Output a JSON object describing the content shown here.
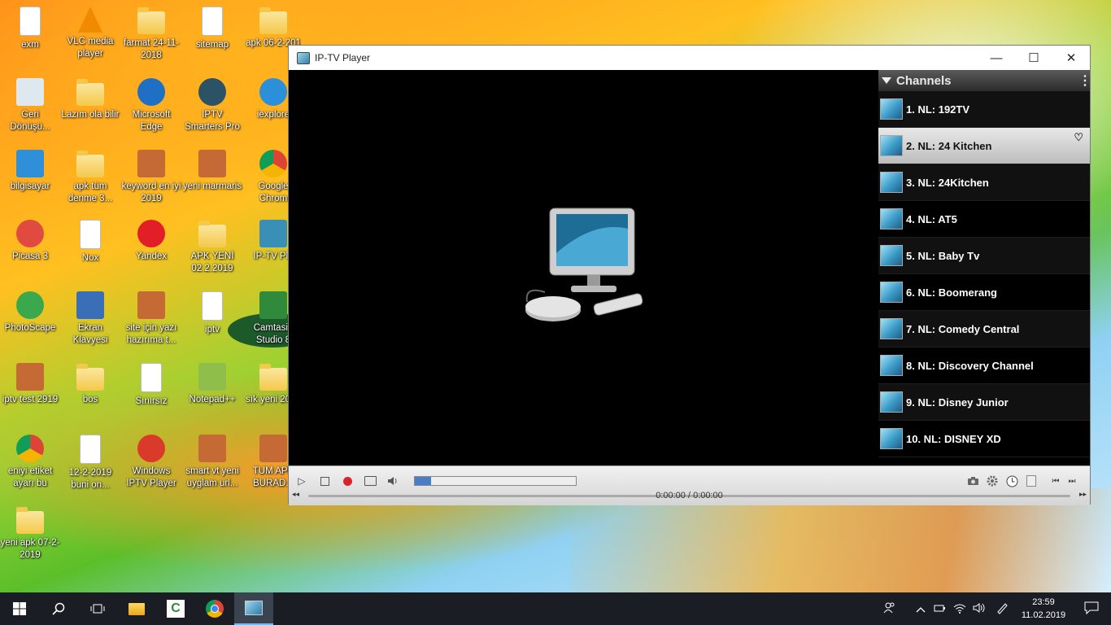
{
  "desktop": {
    "icons": [
      {
        "label": "exm",
        "type": "doc",
        "color": "#ffffff"
      },
      {
        "label": "VLC media player",
        "type": "vlc",
        "color": "#f08a00"
      },
      {
        "label": "farmat 24-11-2018",
        "type": "folder",
        "color": "#f4c84a"
      },
      {
        "label": "sitemap",
        "type": "doc",
        "color": "#ffffff"
      },
      {
        "label": "apk 06-2-201",
        "type": "folder",
        "color": "#f4c84a"
      },
      {
        "label": "Geri Dönüşü...",
        "type": "recycle",
        "color": "#dfe8ee"
      },
      {
        "label": "Lazım ola bilir",
        "type": "folder",
        "color": "#f4c84a"
      },
      {
        "label": "Microsoft Edge",
        "type": "edge",
        "color": "#1f6fc5"
      },
      {
        "label": "IPTV Smarters Pro",
        "type": "round",
        "color": "#2c5365"
      },
      {
        "label": "iexplore",
        "type": "ie",
        "color": "#2b8fd9"
      },
      {
        "label": "bilgisayar",
        "type": "pc",
        "color": "#2f8fd8"
      },
      {
        "label": "apk tüm denme 3...",
        "type": "folder",
        "color": "#f4c84a"
      },
      {
        "label": "keyword en iyi 2019",
        "type": "winrar",
        "color": "#c66a35"
      },
      {
        "label": "yeni marmaris",
        "type": "winrar",
        "color": "#c66a35"
      },
      {
        "label": "Google Chrom",
        "type": "chrome",
        "color": "#db4437"
      },
      {
        "label": "Picasa 3",
        "type": "round",
        "color": "#e04a3f"
      },
      {
        "label": "Nox",
        "type": "doc",
        "color": "#ffffff"
      },
      {
        "label": "Yandex",
        "type": "round",
        "color": "#e21f26"
      },
      {
        "label": "APK YENİ 02.2.2019",
        "type": "folder",
        "color": "#f4c84a"
      },
      {
        "label": "IP-TV Pla",
        "type": "tv",
        "color": "#3a8fb8"
      },
      {
        "label": "PhotoScape",
        "type": "round",
        "color": "#3aa84c"
      },
      {
        "label": "Ekran Klavyesi",
        "type": "keyboard",
        "color": "#3a6fb8"
      },
      {
        "label": "site için yazı hazırıma t...",
        "type": "winrar",
        "color": "#c66a35"
      },
      {
        "label": "iptv",
        "type": "doc",
        "color": "#ffffff"
      },
      {
        "label": "Camtasia Studio 8",
        "type": "camtasia",
        "color": "#2f8a3c"
      },
      {
        "label": "iptv test 2919",
        "type": "winrar",
        "color": "#c66a35"
      },
      {
        "label": "bos",
        "type": "folder",
        "color": "#f4c84a"
      },
      {
        "label": "Sınırsız",
        "type": "doc",
        "color": "#ffffff"
      },
      {
        "label": "Notepad++",
        "type": "notepad",
        "color": "#8fbf4a"
      },
      {
        "label": "sık yeni 2018",
        "type": "folder",
        "color": "#f4c84a"
      },
      {
        "label": "eniyi etiket ayarı bu",
        "type": "chrome",
        "color": "#db4437"
      },
      {
        "label": "12-2-2019 buni on...",
        "type": "doc",
        "color": "#ffffff"
      },
      {
        "label": "Windows IPTV Player",
        "type": "round",
        "color": "#d93a2a"
      },
      {
        "label": "smart vt yeni uyglam url...",
        "type": "winrar",
        "color": "#c66a35"
      },
      {
        "label": "TUM APK BURAD...",
        "type": "winrar",
        "color": "#c66a35"
      },
      {
        "label": "yeni apk 07-2-2019",
        "type": "folder",
        "color": "#f4c84a"
      }
    ]
  },
  "window": {
    "title": "IP-TV Player",
    "minimize_icon": "—",
    "maximize_icon": "☐",
    "close_icon": "✕"
  },
  "channels": {
    "header": "Channels",
    "menu_icon": "⋮",
    "items": [
      {
        "label": "1. NL: 192TV",
        "selected": false
      },
      {
        "label": "2. NL: 24 Kitchen",
        "selected": true
      },
      {
        "label": "3. NL: 24Kitchen",
        "selected": false
      },
      {
        "label": "4. NL: AT5",
        "selected": false
      },
      {
        "label": "5. NL: Baby Tv",
        "selected": false
      },
      {
        "label": "6. NL: Boomerang",
        "selected": false
      },
      {
        "label": "7. NL: Comedy Central",
        "selected": false
      },
      {
        "label": "8. NL: Discovery Channel",
        "selected": false
      },
      {
        "label": "9. NL: Disney Junior",
        "selected": false
      },
      {
        "label": "10. NL: DISNEY XD",
        "selected": false
      }
    ],
    "heart_icon": "♡"
  },
  "controls": {
    "play_icon": "▷",
    "stop_icon": "◻",
    "record_color": "#d9232a",
    "volume_level": 0.1,
    "time": "0:00:00 / 0:00:00"
  },
  "taskbar": {
    "clock_time": "23:59",
    "clock_date": "11.02.2019"
  }
}
